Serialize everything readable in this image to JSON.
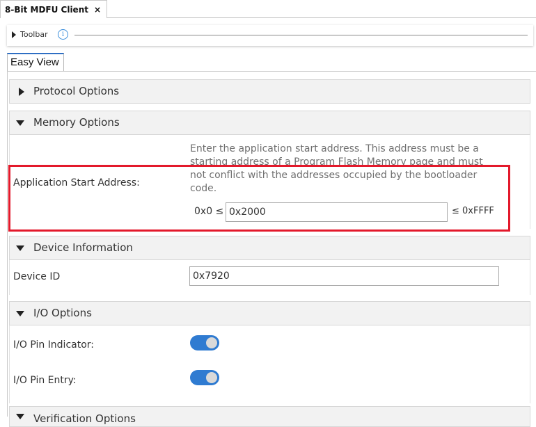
{
  "document_tab": {
    "title": "8-Bit MDFU Client",
    "close_glyph": "×"
  },
  "toolbar": {
    "label": "Toolbar",
    "info_glyph": "i"
  },
  "view_tab": {
    "label": "Easy View"
  },
  "sections": {
    "protocol": {
      "title": "Protocol Options",
      "expanded": false
    },
    "memory": {
      "title": "Memory Options",
      "expanded": true,
      "description": "Enter the application start address. This address must be a starting address of a Program Flash Memory page and must not conflict with the addresses occupied by the bootloader code.",
      "field_label": "Application Start Address:",
      "range_low": "0x0 ≤",
      "value": "0x2000",
      "range_high": "≤ 0xFFFF"
    },
    "device": {
      "title": "Device Information",
      "expanded": true,
      "field_label": "Device ID",
      "value": "0x7920"
    },
    "io": {
      "title": "I/O Options",
      "expanded": true,
      "pin_indicator_label": "I/O Pin Indicator:",
      "pin_indicator_on": true,
      "pin_entry_label": "I/O Pin Entry:",
      "pin_entry_on": true
    },
    "verification": {
      "title": "Verification Options",
      "expanded": true
    }
  },
  "colors": {
    "accent": "#2f7bd1",
    "highlight": "#e3192b",
    "header_bg": "#f2f2f2"
  }
}
